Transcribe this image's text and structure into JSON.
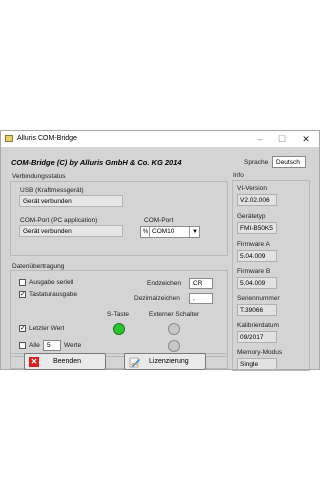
{
  "window": {
    "title": "Alluris COM-Bridge"
  },
  "header": {
    "title": "COM-Bridge (C) by Alluris GmbH & Co. KG 2014",
    "language_label": "Sprache",
    "language_value": "Deutsch"
  },
  "connection": {
    "section_title": "Verbindungsstatus",
    "usb_label": "USB (Kraftmessgerät)",
    "usb_status": "Gerät verbunden",
    "comport_label": "COM-Port (PC application)",
    "comport_status": "Gerät verbunden",
    "comport_select_label": "COM-Port",
    "comport_value": "COM10",
    "comport_prefix": "%"
  },
  "transfer": {
    "section_title": "Datenübertragung",
    "serial_output": {
      "label": "Ausgabe seriell",
      "checked": false
    },
    "keyboard_output": {
      "label": "Tastaturausgabe",
      "checked": true
    },
    "endzeichen_label": "Endzeichen",
    "endzeichen_value": "CR",
    "dezimal_label": "Dezimalzeichen",
    "dezimal_value": ",",
    "stastate_label": "S-Taste",
    "external_label": "Externer Schalter",
    "last_value": {
      "label": "Letzter Wert",
      "checked": true
    },
    "all": {
      "label": "Alle",
      "checked": false,
      "count": "5",
      "suffix": "Werte"
    },
    "colors": {
      "led_on": "#2fc42f",
      "led_off": "#c8c8c8"
    }
  },
  "buttons": {
    "exit_label": "Beenden",
    "license_label": "Lizenzierung"
  },
  "info": {
    "section_title": "Info",
    "items": [
      {
        "label": "VI-Version",
        "value": "V2.02.006"
      },
      {
        "label": "Gerätetyp",
        "value": "FMI-B50K5"
      },
      {
        "label": "Firmware A",
        "value": "5.04.009"
      },
      {
        "label": "Firmware B",
        "value": "5.04.009"
      },
      {
        "label": "Seriennummer",
        "value": "T.39066"
      },
      {
        "label": "Kalibrierdatum",
        "value": "09/2017"
      },
      {
        "label": "Memory-Modus",
        "value": "Single"
      }
    ]
  }
}
